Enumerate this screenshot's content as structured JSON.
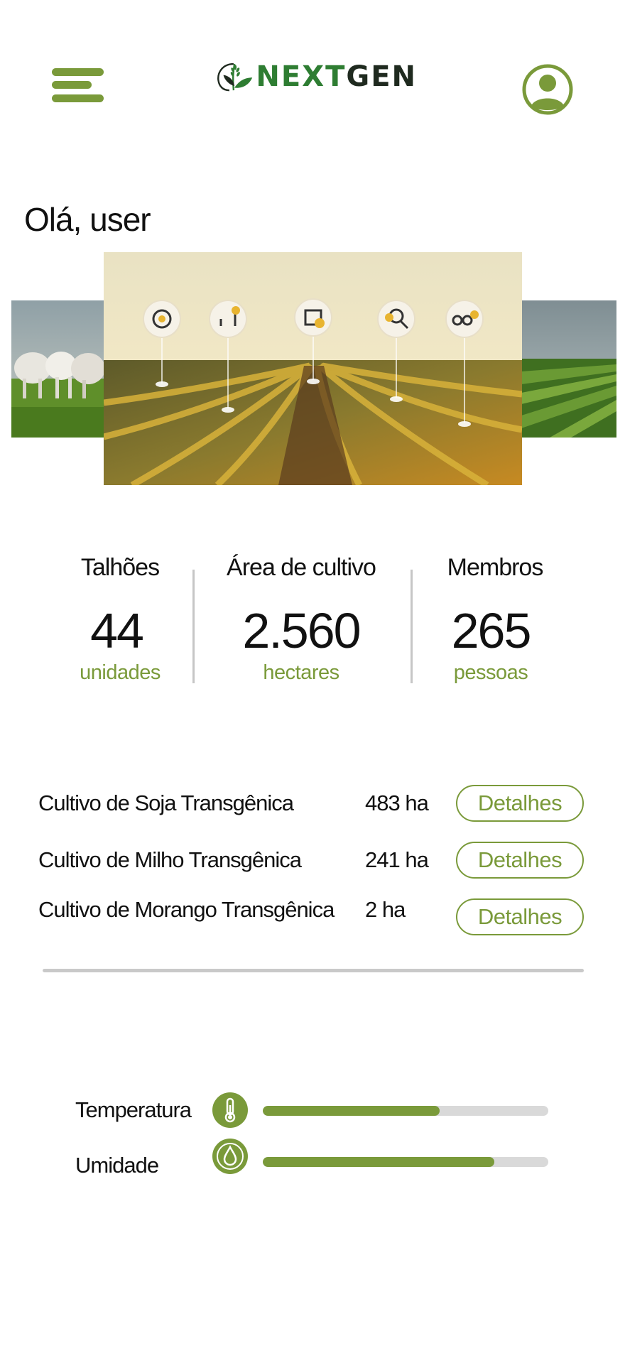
{
  "theme": {
    "accent": "#7a9a3a",
    "logo_green": "#2e7d32"
  },
  "header": {
    "menu_icon": "hamburger-menu-icon",
    "logo": {
      "part1": "NEXT",
      "part2": "GEN"
    },
    "profile_icon": "user-avatar-icon"
  },
  "greeting": "Olá, user",
  "carousel": {
    "slides": [
      "cattle-pasture-image",
      "smart-farm-field-image",
      "green-crop-rows-image"
    ]
  },
  "stats": [
    {
      "label": "Talhões",
      "value": "44",
      "unit": "unidades"
    },
    {
      "label": "Área de cultivo",
      "value": "2.560",
      "unit": "hectares"
    },
    {
      "label": "Membros",
      "value": "265",
      "unit": "pessoas"
    }
  ],
  "crops": [
    {
      "name": "Cultivo de Soja Transgênica",
      "area": "483 ha",
      "button": "Detalhes"
    },
    {
      "name": "Cultivo de Milho Transgênica",
      "area": "241 ha",
      "button": "Detalhes"
    },
    {
      "name": "Cultivo de Morango Transgênica",
      "area": "2 ha",
      "button": "Detalhes"
    }
  ],
  "sensors": [
    {
      "label": "Temperatura",
      "icon": "thermometer-icon",
      "level": 0.62
    },
    {
      "label": "Umidade",
      "icon": "water-drop-icon",
      "level": 0.81
    }
  ]
}
